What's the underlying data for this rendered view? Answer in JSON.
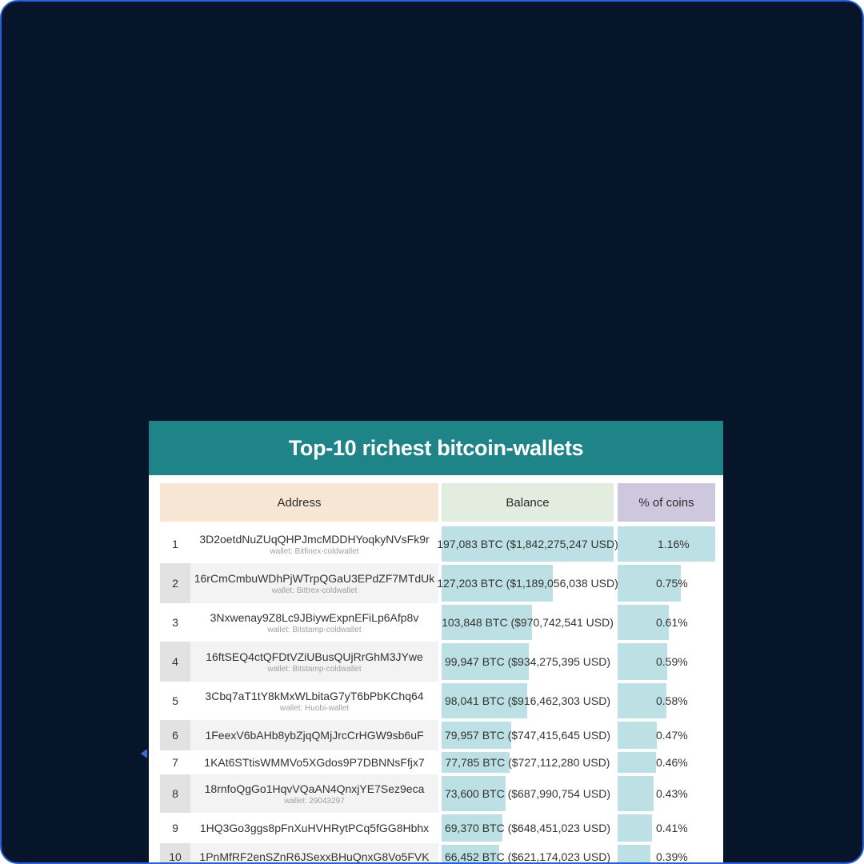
{
  "title": "Top-10 richest bitcoin-wallets",
  "headers": {
    "address": "Address",
    "balance": "Balance",
    "pct": "% of coins"
  },
  "colors": {
    "background": "#07152b",
    "border": "#2a5fd8",
    "header": "#1e8488",
    "bar": "#bde0e4"
  },
  "rows": [
    {
      "rank": "1",
      "address": "3D2oetdNuZUqQHPJmcMDDHYoqkyNVsFk9r",
      "wallet": "wallet: Bitfinex-coldwallet",
      "balance": "197,083 BTC ($1,842,275,247 USD)",
      "pct": "1.16%",
      "btc": 197083,
      "pct_value": 1.16
    },
    {
      "rank": "2",
      "address": "16rCmCmbuWDhPjWTrpQGaU3EPdZF7MTdUk",
      "wallet": "wallet: Bittrex-coldwallet",
      "balance": "127,203 BTC ($1,189,056,038 USD)",
      "pct": "0.75%",
      "btc": 127203,
      "pct_value": 0.75
    },
    {
      "rank": "3",
      "address": "3Nxwenay9Z8Lc9JBiywExpnEFiLp6Afp8v",
      "wallet": "wallet: Bitstamp-coldwallet",
      "balance": "103,848 BTC ($970,742,541 USD)",
      "pct": "0.61%",
      "btc": 103848,
      "pct_value": 0.61
    },
    {
      "rank": "4",
      "address": "16ftSEQ4ctQFDtVZiUBusQUjRrGhM3JYwe",
      "wallet": "wallet: Bitstamp-coldwallet",
      "balance": "99,947 BTC ($934,275,395 USD)",
      "pct": "0.59%",
      "btc": 99947,
      "pct_value": 0.59
    },
    {
      "rank": "5",
      "address": "3Cbq7aT1tY8kMxWLbitaG7yT6bPbKChq64",
      "wallet": "wallet: Huobi-wallet",
      "balance": "98,041 BTC ($916,462,303 USD)",
      "pct": "0.58%",
      "btc": 98041,
      "pct_value": 0.58
    },
    {
      "rank": "6",
      "address": "1FeexV6bAHb8ybZjqQMjJrcCrHGW9sb6uF",
      "wallet": "",
      "balance": "79,957 BTC ($747,415,645 USD)",
      "pct": "0.47%",
      "btc": 79957,
      "pct_value": 0.47
    },
    {
      "rank": "7",
      "address": "1KAt6STtisWMMVo5XGdos9P7DBNNsFfjx7",
      "wallet": "",
      "balance": "77,785 BTC ($727,112,280 USD)",
      "pct": "0.46%",
      "btc": 77785,
      "pct_value": 0.46
    },
    {
      "rank": "8",
      "address": "18rnfoQgGo1HqvVQaAN4QnxjYE7Sez9eca",
      "wallet": "wallet: 29043297",
      "balance": "73,600 BTC ($687,990,754 USD)",
      "pct": "0.43%",
      "btc": 73600,
      "pct_value": 0.43
    },
    {
      "rank": "9",
      "address": "1HQ3Go3ggs8pFnXuHVHRytPCq5fGG8Hbhx",
      "wallet": "",
      "balance": "69,370 BTC ($648,451,023 USD)",
      "pct": "0.41%",
      "btc": 69370,
      "pct_value": 0.41
    },
    {
      "rank": "10",
      "address": "1PnMfRF2enSZnR6JSexxBHuQnxG8Vo5FVK",
      "wallet": "",
      "balance": "66,452 BTC ($621,174,023 USD)",
      "pct": "0.39%",
      "btc": 66452,
      "pct_value": 0.39
    }
  ]
}
